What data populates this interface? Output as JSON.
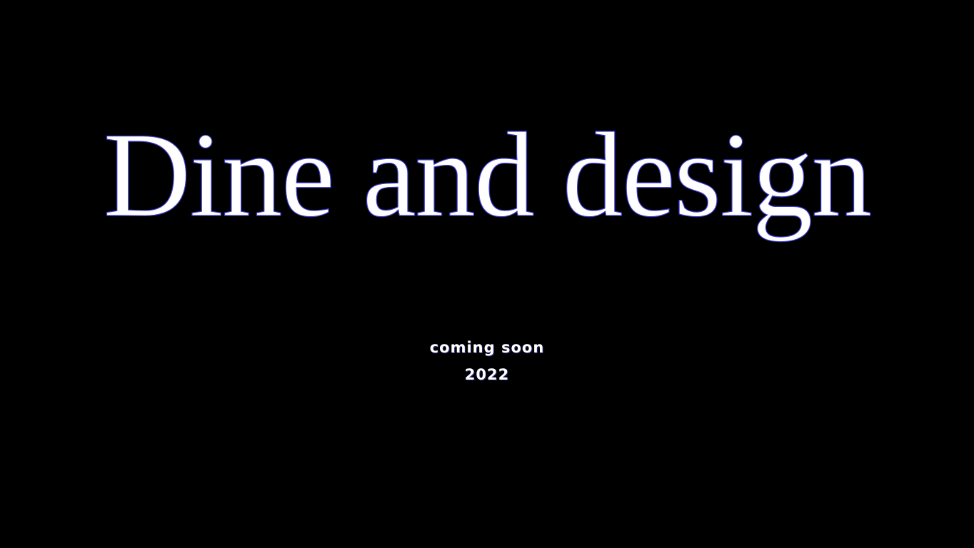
{
  "hero": {
    "title": "Dine and design"
  },
  "tagline": {
    "line1": "coming soon",
    "line2": "2022"
  },
  "colors": {
    "background": "#000000",
    "text": "#ffffff",
    "title_outline": "#3c3cd2"
  }
}
